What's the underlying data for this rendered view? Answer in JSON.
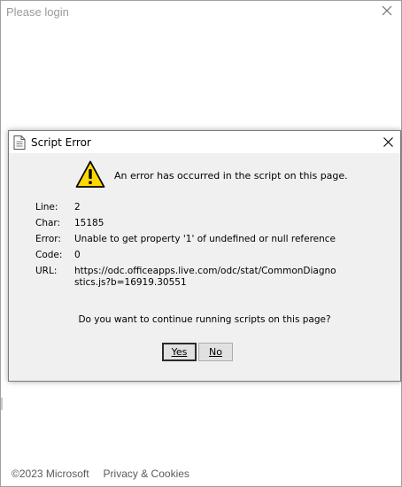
{
  "outer": {
    "title": "Please login",
    "footer_copyright": "©2023 Microsoft",
    "footer_privacy": "Privacy & Cookies"
  },
  "dialog": {
    "title": "Script Error",
    "message": "An error has occurred in the script on this page.",
    "details": [
      {
        "label": "Line:",
        "value": "2"
      },
      {
        "label": "Char:",
        "value": "15185"
      },
      {
        "label": "Error:",
        "value": "Unable to get property '1' of undefined or null reference"
      },
      {
        "label": "Code:",
        "value": "0"
      },
      {
        "label": "URL:",
        "value": "https://odc.officeapps.live.com/odc/stat/CommonDiagnostics.js?b=16919.30551"
      }
    ],
    "prompt": "Do you want to continue running scripts on this page?",
    "yes_label": "Yes",
    "no_label": "No"
  },
  "colors": {
    "dialog_bg": "#f0f0f0",
    "warning_yellow": "#ffd800"
  }
}
